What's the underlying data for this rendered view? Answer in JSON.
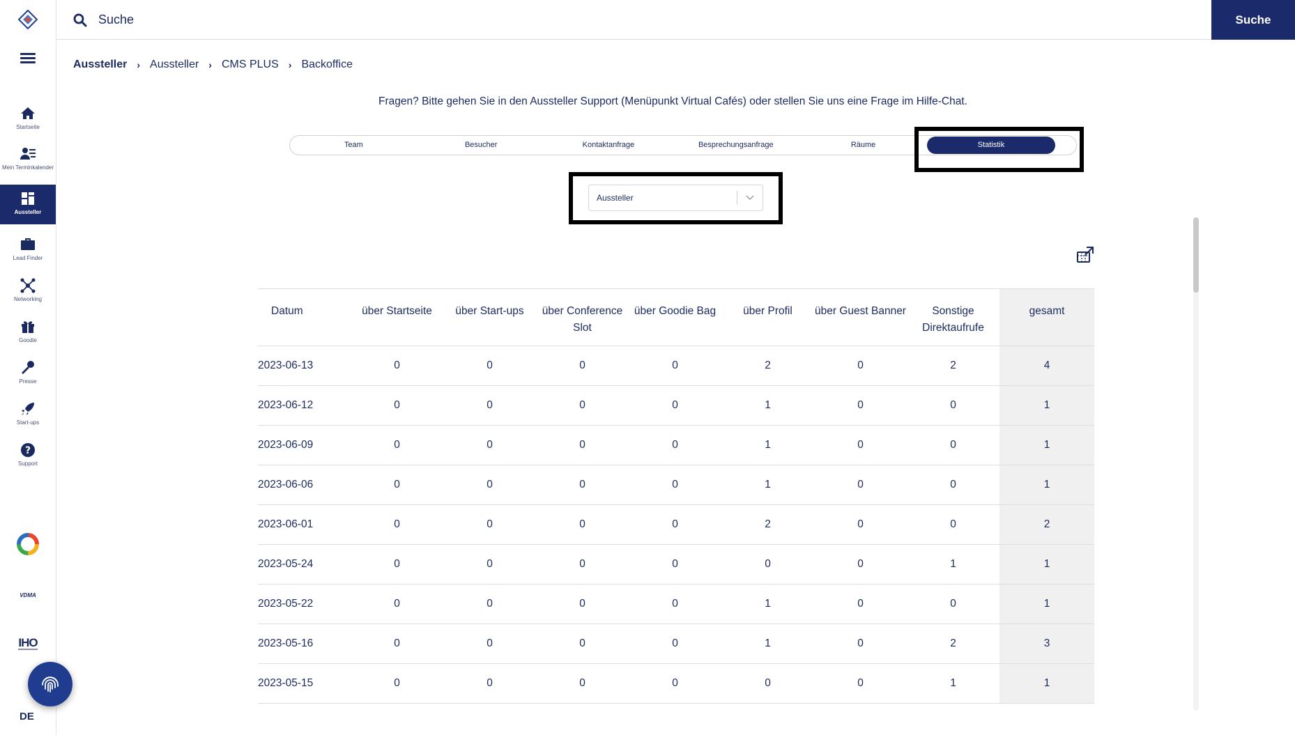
{
  "sidebar": {
    "items": [
      {
        "label": "Startseite",
        "icon": "home-icon"
      },
      {
        "label": "Mein Terminkalender",
        "icon": "calendar-user-icon"
      },
      {
        "label": "Aussteller",
        "icon": "exhibitor-icon",
        "active": true
      },
      {
        "label": "Lead Finder",
        "icon": "briefcase-icon"
      },
      {
        "label": "Networking",
        "icon": "network-icon"
      },
      {
        "label": "Goodie",
        "icon": "gift-icon"
      },
      {
        "label": "Presse",
        "icon": "microphone-icon"
      },
      {
        "label": "Start-ups",
        "icon": "rocket-icon"
      },
      {
        "label": "Support",
        "icon": "help-icon"
      }
    ],
    "partners": {
      "vdma": "VDMA",
      "iho": "IHO"
    },
    "language": "DE"
  },
  "topbar": {
    "search_placeholder": "Suche",
    "search_button": "Suche"
  },
  "breadcrumb": [
    "Aussteller",
    "Aussteller",
    "CMS PLUS",
    "Backoffice"
  ],
  "help_text": "Fragen? Bitte gehen Sie in den Aussteller Support (Menüpunkt Virtual Cafés) oder stellen Sie uns eine Frage im Hilfe-Chat.",
  "tabs": [
    {
      "label": "Team"
    },
    {
      "label": "Besucher"
    },
    {
      "label": "Kontaktanfrage"
    },
    {
      "label": "Besprechungsanfrage"
    },
    {
      "label": "Räume"
    },
    {
      "label": "Statistik",
      "active": true
    }
  ],
  "dropdown": {
    "selected": "Aussteller"
  },
  "table": {
    "headers": [
      "Datum",
      "über Startseite",
      "über Start-ups",
      "über Conference Slot",
      "über Goodie Bag",
      "über Profil",
      "über Guest Banner",
      "Sonstige Direktaufrufe",
      "gesamt"
    ],
    "rows": [
      [
        "2023-06-13",
        "0",
        "0",
        "0",
        "0",
        "2",
        "0",
        "2",
        "4"
      ],
      [
        "2023-06-12",
        "0",
        "0",
        "0",
        "0",
        "1",
        "0",
        "0",
        "1"
      ],
      [
        "2023-06-09",
        "0",
        "0",
        "0",
        "0",
        "1",
        "0",
        "0",
        "1"
      ],
      [
        "2023-06-06",
        "0",
        "0",
        "0",
        "0",
        "1",
        "0",
        "0",
        "1"
      ],
      [
        "2023-06-01",
        "0",
        "0",
        "0",
        "0",
        "2",
        "0",
        "0",
        "2"
      ],
      [
        "2023-05-24",
        "0",
        "0",
        "0",
        "0",
        "0",
        "0",
        "1",
        "1"
      ],
      [
        "2023-05-22",
        "0",
        "0",
        "0",
        "0",
        "1",
        "0",
        "0",
        "1"
      ],
      [
        "2023-05-16",
        "0",
        "0",
        "0",
        "0",
        "1",
        "0",
        "2",
        "3"
      ],
      [
        "2023-05-15",
        "0",
        "0",
        "0",
        "0",
        "0",
        "0",
        "1",
        "1"
      ]
    ]
  },
  "colors": {
    "primary": "#1b2a6b",
    "text": "#1b2a5e",
    "highlight_box": "#000000",
    "total_column_bg": "#f0f0f0"
  }
}
